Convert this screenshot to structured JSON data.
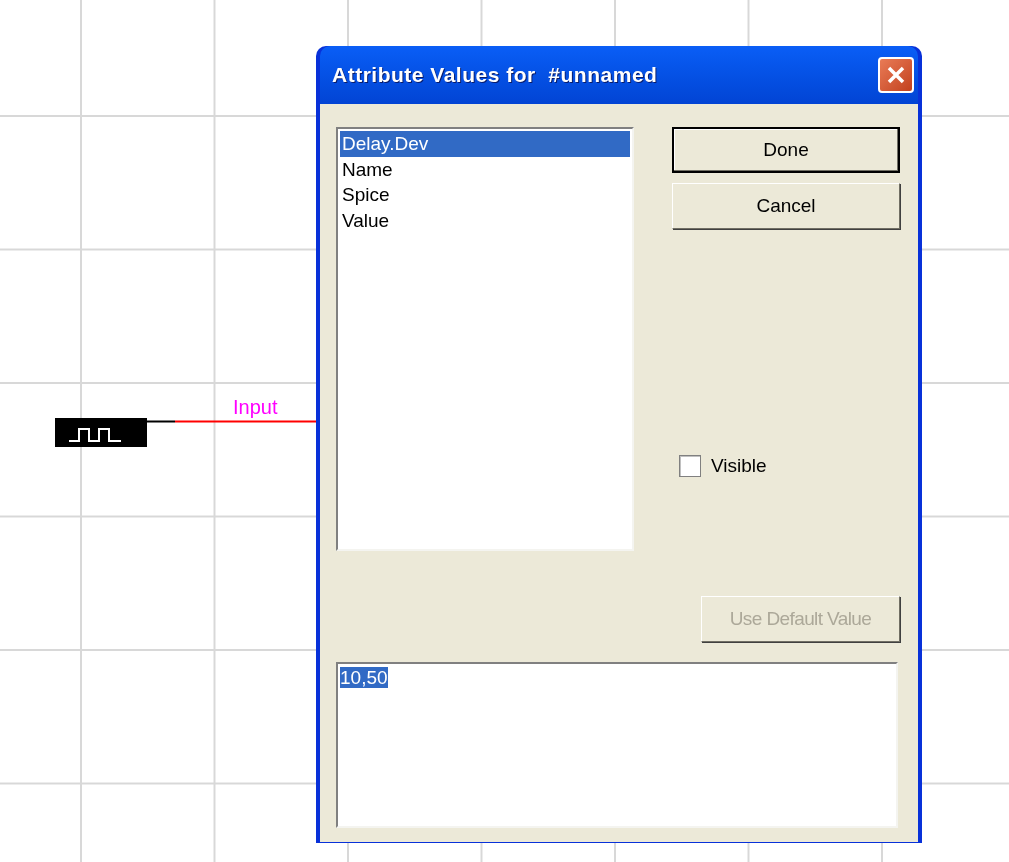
{
  "canvas": {
    "wire_label": "Input"
  },
  "dialog": {
    "title": "Attribute Values for  #unnamed",
    "attributes": [
      {
        "label": "Delay.Dev",
        "selected": true
      },
      {
        "label": "Name",
        "selected": false
      },
      {
        "label": "Spice",
        "selected": false
      },
      {
        "label": "Value",
        "selected": false
      }
    ],
    "buttons": [
      {
        "label": "Done",
        "default": true,
        "disabled": false
      },
      {
        "label": "Cancel",
        "default": false,
        "disabled": false
      }
    ],
    "visible_checkbox": {
      "label": "Visible",
      "checked": false
    },
    "default_button": {
      "label": "Use Default Value",
      "disabled": true
    },
    "value_field": {
      "value": "10,50",
      "selected": true
    }
  }
}
